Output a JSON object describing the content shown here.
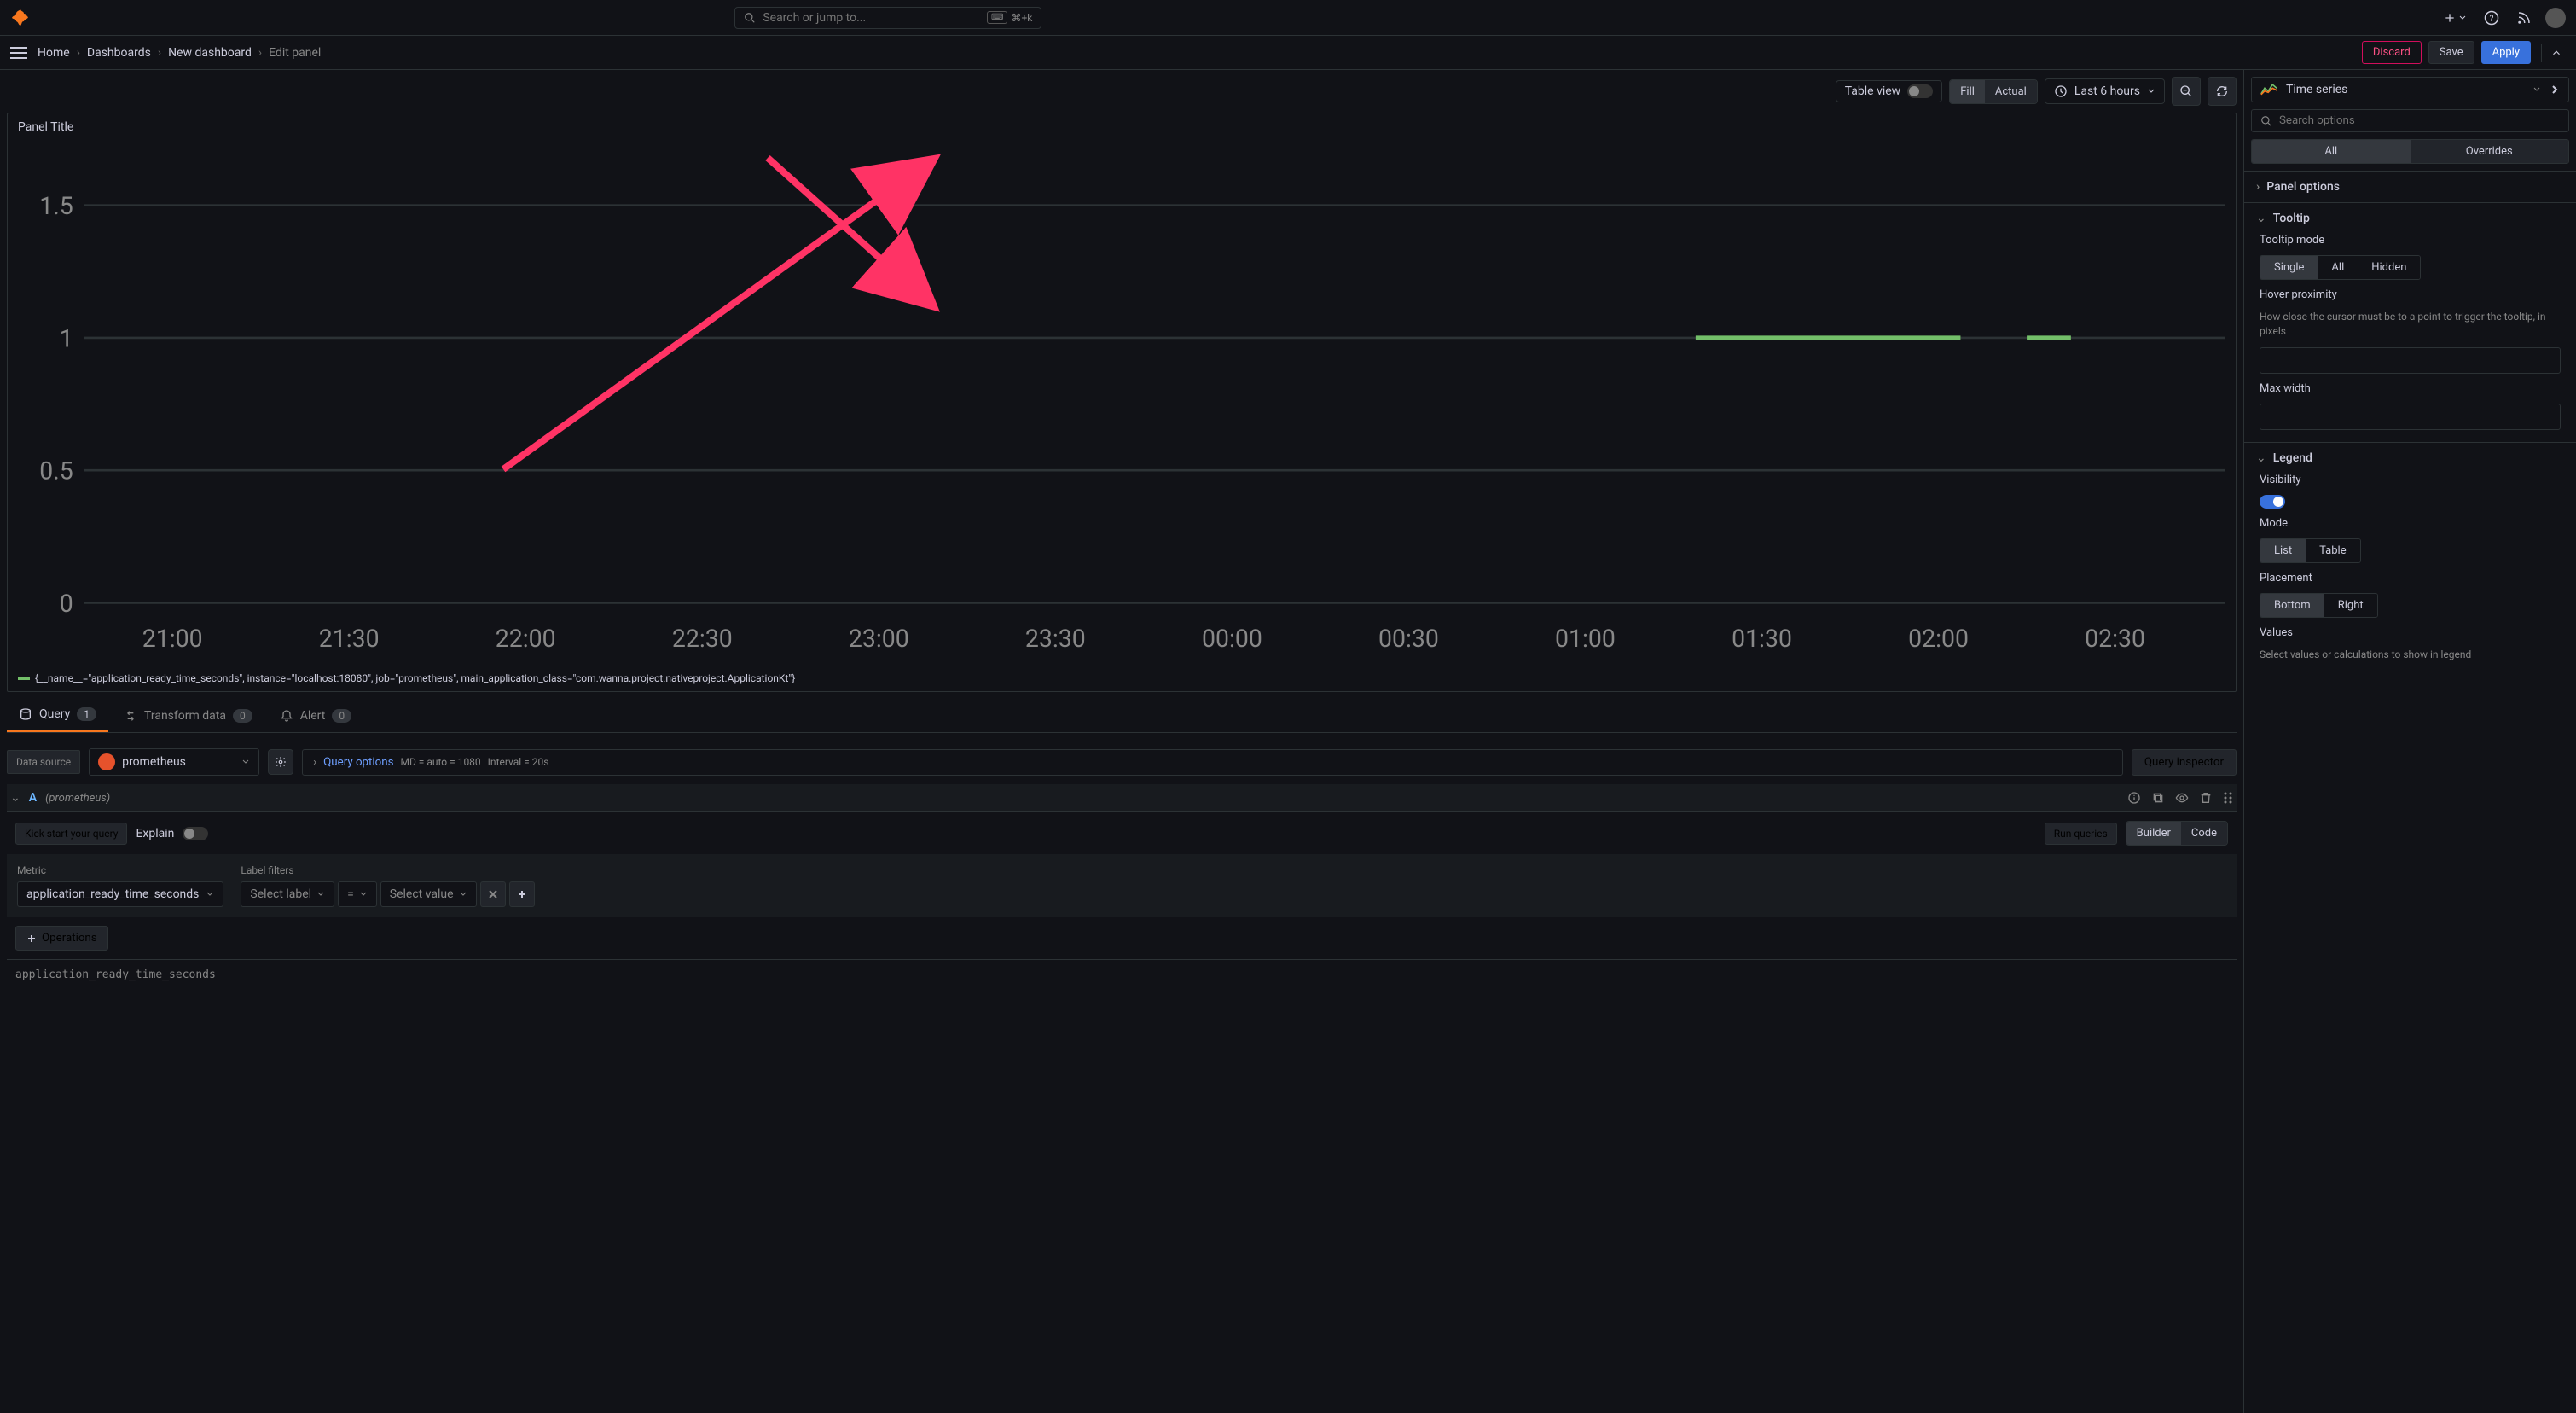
{
  "topbar": {
    "search_placeholder": "Search or jump to...",
    "shortcut": "⌘+k"
  },
  "breadcrumb": {
    "home": "Home",
    "dashboards": "Dashboards",
    "new_dashboard": "New dashboard",
    "edit_panel": "Edit panel"
  },
  "actions": {
    "discard": "Discard",
    "save": "Save",
    "apply": "Apply"
  },
  "toolbar": {
    "table_view": "Table view",
    "fill": "Fill",
    "actual": "Actual",
    "time_range": "Last 6 hours"
  },
  "panel": {
    "title": "Panel Title",
    "legend": "{__name__=\"application_ready_time_seconds\", instance=\"localhost:18080\", job=\"prometheus\", main_application_class=\"com.wanna.project.nativeproject.ApplicationKt\"}"
  },
  "chart_data": {
    "type": "line",
    "title": "Panel Title",
    "xlabel": "",
    "ylabel": "",
    "ylim": [
      0,
      1.6
    ],
    "yticks": [
      0,
      0.5,
      1,
      1.5
    ],
    "xticks": [
      "21:00",
      "21:30",
      "22:00",
      "22:30",
      "23:00",
      "23:30",
      "00:00",
      "00:30",
      "01:00",
      "01:30",
      "02:00",
      "02:30"
    ],
    "series": [
      {
        "name": "application_ready_time_seconds",
        "color": "#73bf69",
        "x": [
          "01:00",
          "01:30",
          "01:45"
        ],
        "y": [
          1.0,
          1.0,
          1.0
        ]
      }
    ]
  },
  "query_tabs": {
    "query": "Query",
    "query_count": "1",
    "transform": "Transform data",
    "transform_count": "0",
    "alert": "Alert",
    "alert_count": "0"
  },
  "datasource": {
    "label": "Data source",
    "name": "prometheus",
    "query_options": "Query options",
    "md": "MD = auto = 1080",
    "interval": "Interval = 20s",
    "inspector": "Query inspector"
  },
  "query_row": {
    "letter": "A",
    "ds_name": "(prometheus)",
    "kick_start": "Kick start your query",
    "explain": "Explain",
    "run": "Run queries",
    "builder": "Builder",
    "code": "Code"
  },
  "metric": {
    "label": "Metric",
    "value": "application_ready_time_seconds",
    "filters_label": "Label filters",
    "select_label": "Select label",
    "eq": "=",
    "select_value": "Select value",
    "operations": "Operations",
    "expression": "application_ready_time_seconds"
  },
  "right": {
    "viz_name": "Time series",
    "search_placeholder": "Search options",
    "tab_all": "All",
    "tab_overrides": "Overrides",
    "panel_options": "Panel options",
    "tooltip": {
      "title": "Tooltip",
      "mode_label": "Tooltip mode",
      "single": "Single",
      "all": "All",
      "hidden": "Hidden",
      "hover_label": "Hover proximity",
      "hover_desc": "How close the cursor must be to a point to trigger the tooltip, in pixels",
      "max_width": "Max width"
    },
    "legend": {
      "title": "Legend",
      "visibility": "Visibility",
      "mode": "Mode",
      "list": "List",
      "table": "Table",
      "placement": "Placement",
      "bottom": "Bottom",
      "right": "Right",
      "values": "Values",
      "values_desc": "Select values or calculations to show in legend"
    }
  }
}
